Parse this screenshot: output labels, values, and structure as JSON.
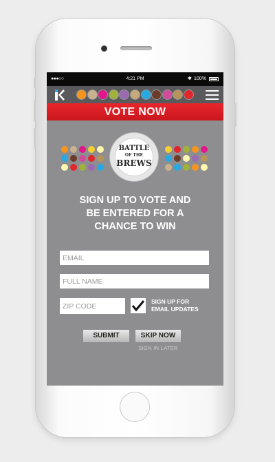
{
  "status_bar": {
    "signal": "●●●○○",
    "time": "4:21 PM",
    "bluetooth": "✱",
    "battery": "100%"
  },
  "nav": {
    "logo_icon": "k-logo-icon",
    "menu_icon": "hamburger-menu-icon",
    "dot_colors": [
      "#f7941d",
      "#c9b28d",
      "#e2178c",
      "#a0b23b",
      "#9b6ab0",
      "#c7a87b",
      "#27a9e1",
      "#6d3b2a",
      "#d14a9b",
      "#b6945a",
      "#e1262c"
    ]
  },
  "banner": {
    "label": "VOTE NOW"
  },
  "badge": {
    "line1": "BATTLE",
    "line2": "OF THE",
    "line3": "BREWS"
  },
  "left_dot_colors": [
    "#f7941d",
    "#c9b28d",
    "#e2178c",
    "#f2cf33",
    "#fff6b0",
    "#27a9e1",
    "#6d3b2a",
    "#d14a9b",
    "#e1262c",
    "#b6945a",
    "#fff6b0",
    "#e1262c",
    "#a0b23b",
    "#9b6ab0",
    "#27a9e1"
  ],
  "right_dot_colors": [
    "#f2cf33",
    "#e1262c",
    "#a0b23b",
    "#f7941d",
    "#e2178c",
    "#27a9e1",
    "#6d3b2a",
    "#fff6b0",
    "#9b6ab0",
    "#b6945a",
    "#c9b28d",
    "#27a9e1",
    "#a0b23b",
    "#f7941d",
    "#fff6b0"
  ],
  "headline": [
    "SIGN UP TO VOTE AND",
    "BE ENTERED FOR A",
    "CHANCE TO WIN"
  ],
  "form": {
    "email_placeholder": "EMAIL",
    "name_placeholder": "FULL NAME",
    "zip_placeholder": "ZIP CODE",
    "checkbox_checked": true,
    "checkbox_label_1": "SIGN UP FOR",
    "checkbox_label_2": "EMAIL UPDATES",
    "submit_label": "SUBMIT",
    "skip_label": "SKIP NOW",
    "later_label": "SIGN IN LATER"
  }
}
